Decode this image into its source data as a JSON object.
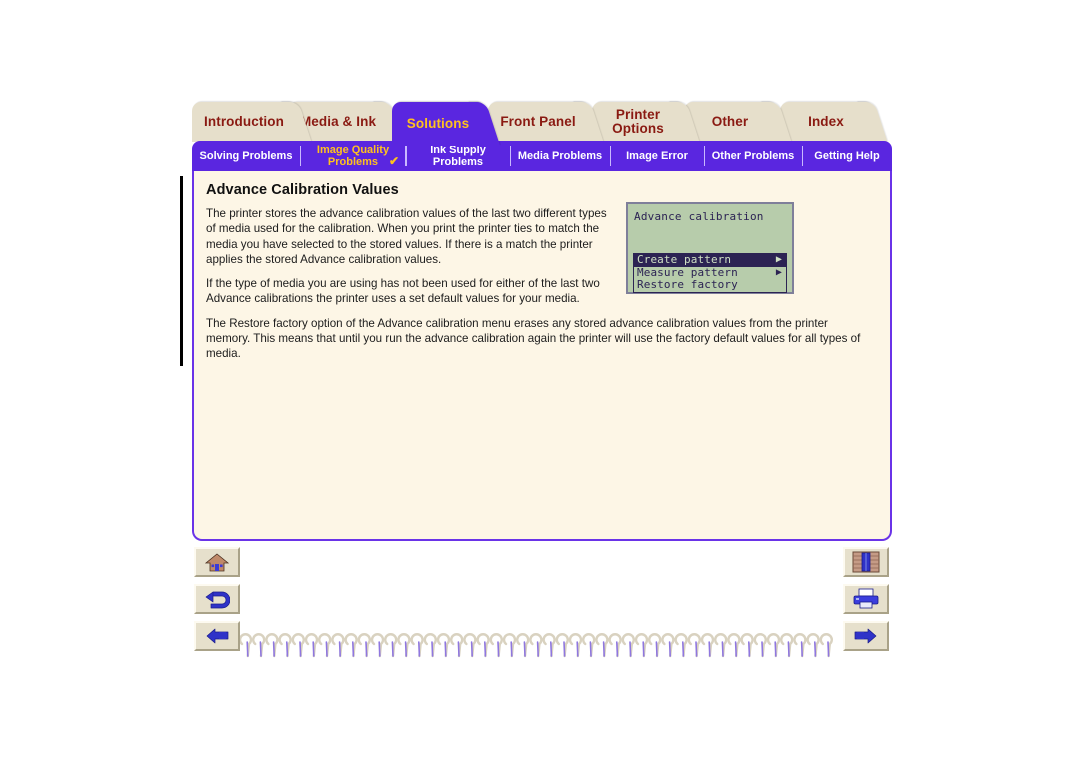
{
  "document": {
    "title": "Advance Calibration Values"
  },
  "main_tabs": [
    {
      "id": "introduction",
      "label": "Introduction",
      "active": false
    },
    {
      "id": "media-and-ink",
      "label": "Media & Ink",
      "active": false
    },
    {
      "id": "solutions",
      "label": "Solutions",
      "active": true
    },
    {
      "id": "front-panel",
      "label": "Front Panel",
      "active": false
    },
    {
      "id": "printer-options",
      "label": "Printer Options",
      "active": false
    },
    {
      "id": "other",
      "label": "Other",
      "active": false
    },
    {
      "id": "index",
      "label": "Index",
      "active": false
    }
  ],
  "sub_tabs": [
    {
      "id": "solving-problems",
      "label": "Solving Problems",
      "current": false,
      "check": ""
    },
    {
      "id": "image-quality-problems",
      "label": "Image Quality Problems",
      "current": true,
      "check": "✔"
    },
    {
      "id": "ink-supply-problems",
      "label": "Ink Supply Problems",
      "current": false,
      "check": ""
    },
    {
      "id": "media-problems",
      "label": "Media Problems",
      "current": false,
      "check": ""
    },
    {
      "id": "image-error",
      "label": "Image Error",
      "current": false,
      "check": ""
    },
    {
      "id": "other-problems",
      "label": "Other Problems",
      "current": false,
      "check": ""
    },
    {
      "id": "getting-help",
      "label": "Getting Help",
      "current": false,
      "check": ""
    }
  ],
  "content": {
    "heading": "Advance Calibration Values",
    "paragraph_1": "The printer stores the advance calibration values of the last two different types of media used for the calibration. When you print the printer ties to match the media you have selected to the stored values. If there is a match the printer applies the stored Advance calibration values.",
    "paragraph_2": "If the type of media you are using has not been used for either of the last two Advance calibrations the printer uses a set default values for your media.",
    "paragraph_3": "The Restore factory option of the Advance calibration menu erases any stored advance calibration values from the printer memory. This means that until you run the advance calibration again the printer will use the factory default values for all types of media."
  },
  "front_panel_display": {
    "title": "Advance calibration",
    "menu_items": [
      {
        "label": "Create pattern",
        "selected": true,
        "arrow": "▶"
      },
      {
        "label": "Measure pattern",
        "selected": false,
        "arrow": "▶"
      },
      {
        "label": "Restore factory",
        "selected": false,
        "arrow": ""
      }
    ],
    "colors": {
      "screen_background": "#b7ccab",
      "text": "#2c2353",
      "selection_background": "#2c2353",
      "selection_text": "#cfe0c4"
    }
  },
  "nav_buttons": {
    "left": [
      {
        "id": "home",
        "icon": "home-icon",
        "tooltip": "Home"
      },
      {
        "id": "back",
        "icon": "back-arrow-icon",
        "tooltip": "Back"
      },
      {
        "id": "previous",
        "icon": "hand-left-icon",
        "tooltip": "Previous page"
      }
    ],
    "right": [
      {
        "id": "bookshelf",
        "icon": "bookshelf-icon",
        "tooltip": "Bookshelf"
      },
      {
        "id": "print",
        "icon": "printer-icon",
        "tooltip": "Print"
      },
      {
        "id": "next",
        "icon": "hand-right-icon",
        "tooltip": "Next page"
      }
    ]
  },
  "theme": {
    "accent_purple": "#5a26e0",
    "tab_inactive": "#e6dfcb",
    "tab_text": "#8a1a12",
    "active_tab_text": "#ffc21e",
    "page_background": "#fdf6e6",
    "button_face": "#e6e0cc"
  },
  "binding": {
    "coil_count": 45
  }
}
